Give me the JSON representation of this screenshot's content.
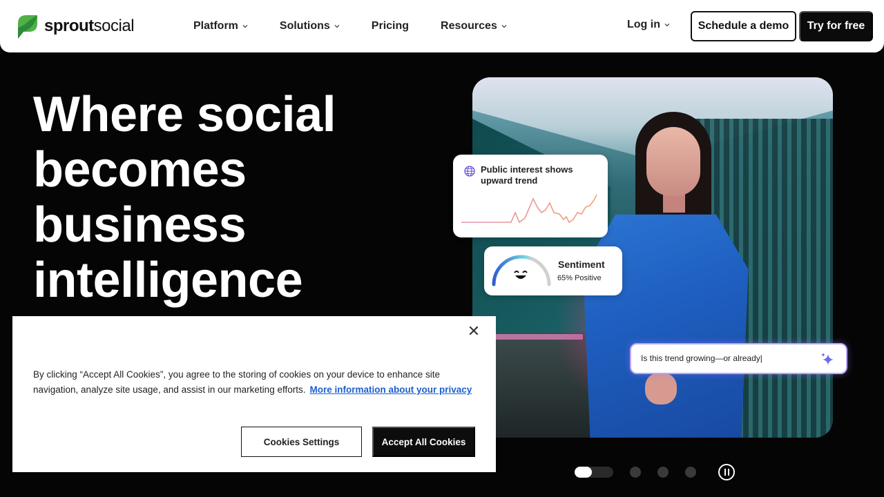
{
  "brand": {
    "logo_part1": "sprout",
    "logo_part2": "social",
    "logo_icon": "leaf-icon",
    "accent": "#3cb04a"
  },
  "nav": {
    "items": [
      {
        "label": "Platform",
        "has_dropdown": true
      },
      {
        "label": "Solutions",
        "has_dropdown": true
      },
      {
        "label": "Pricing",
        "has_dropdown": false
      },
      {
        "label": "Resources",
        "has_dropdown": true
      }
    ],
    "login_label": "Log in",
    "demo_label": "Schedule a demo",
    "try_label": "Try for free"
  },
  "hero": {
    "title_line1": "Where social",
    "title_line2": "becomes",
    "title_line3": "business",
    "title_line4": "intelligence"
  },
  "cards": {
    "trend_text": "Public interest shows upward trend",
    "trend_icon": "globe-icon",
    "sentiment_title": "Sentiment",
    "sentiment_value": "65% Positive",
    "ask_text": "Is this trend growing—or already|",
    "ask_icon": "sparkle-icon"
  },
  "carousel": {
    "slides": 4,
    "active": 0,
    "active_progress": 0.45,
    "pause_icon": "pause-icon"
  },
  "cookie": {
    "message": "By clicking “Accept All Cookies”, you agree to the storing of cookies on your device to enhance site navigation, analyze site usage, and assist in our marketing efforts.",
    "link_label": "More information about your privacy",
    "settings_label": "Cookies Settings",
    "accept_label": "Accept All Cookies",
    "close_icon": "close-icon",
    "close_glyph": "✕"
  }
}
